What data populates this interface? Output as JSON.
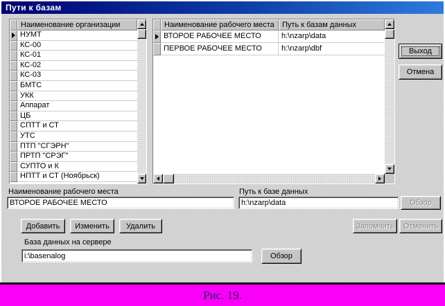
{
  "window": {
    "title": "Пути к базам"
  },
  "org_list": {
    "header": "Наименование организации",
    "selected_index": 0,
    "items": [
      "НУМТ",
      "КС-00",
      "КС-01",
      "КС-02",
      "КС-03",
      "БМТС",
      "УКК",
      "Аппарат",
      "ЦБ",
      "СПТТ и СТ",
      "УТС",
      "ПТП \"СГЭРН\"",
      "ПРТП \"СРЭГ\"",
      "СУПТО и К",
      "НПТТ и СТ (Ноябрьск)"
    ]
  },
  "workplace_table": {
    "columns": [
      "Наименование рабочего места",
      "Путь к базам данных"
    ],
    "selected_index": 0,
    "rows": [
      {
        "name": "ВТОРОЕ РАБОЧЕЕ МЕСТО",
        "path": "h:\\nzarp\\data"
      },
      {
        "name": "ПЕРВОЕ РАБОЧЕЕ МЕСТО",
        "path": "h:\\nzarp\\dbf"
      }
    ]
  },
  "buttons": {
    "exit": "Выход",
    "cancel": "Отмена",
    "add": "Добавить",
    "edit": "Изменить",
    "delete": "Удалить",
    "remember": "Запомнить",
    "undo": "Отменить",
    "browse_path": "Обзор",
    "browse_server": "Обзор"
  },
  "fields": {
    "workplace_label": "Наименование рабочего места",
    "workplace_value": "ВТОРОЕ РАБОЧЕЕ МЕСТО",
    "path_label": "Путь к базе данных",
    "path_value": "h:\\nzarp\\data",
    "server_db_label": "База данных на сервере",
    "server_db_value": "i:\\basenalog"
  },
  "caption": {
    "text": "Рис. 19."
  },
  "colors": {
    "titlebar_start": "#000070",
    "titlebar_end": "#2e7bdd",
    "caption_bg": "#ff00ff",
    "dialog_gray": "#c9c9c9"
  }
}
